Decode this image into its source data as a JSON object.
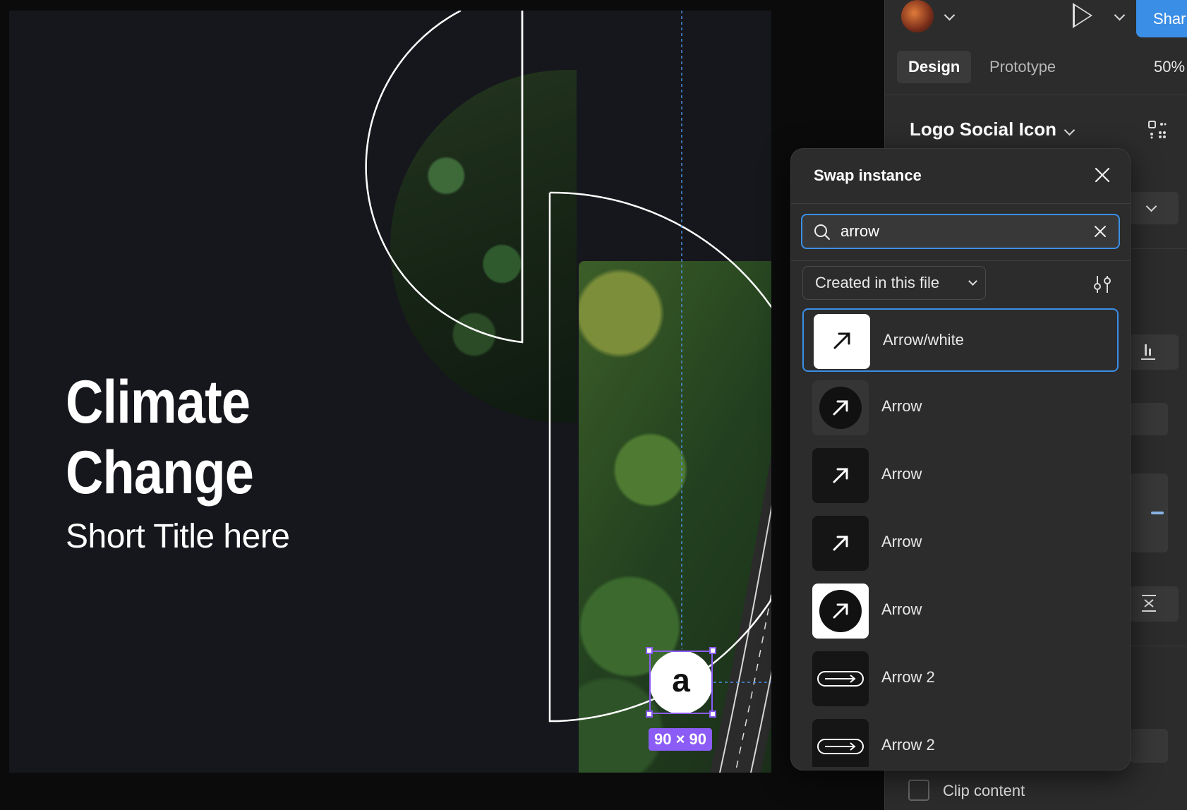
{
  "canvas": {
    "title_line1": "Climate",
    "title_line2": "Change",
    "subtitle": "Short Title here",
    "selection": {
      "size_label": "90 × 90",
      "glyph": "a"
    }
  },
  "topbar": {
    "share_label": "Shar",
    "zoom": "50%"
  },
  "panel": {
    "tabs": [
      {
        "label": "Design",
        "active": true
      },
      {
        "label": "Prototype",
        "active": false
      }
    ],
    "component_name": "Logo Social Icon",
    "clip_content_label": "Clip content"
  },
  "swap_instance": {
    "title": "Swap instance",
    "search": {
      "value": "arrow"
    },
    "filter": "Created in this file",
    "results": [
      {
        "label": "Arrow/white",
        "style": "white-square",
        "selected": true
      },
      {
        "label": "Arrow",
        "style": "dark-circle",
        "selected": false
      },
      {
        "label": "Arrow",
        "style": "dark-square",
        "selected": false
      },
      {
        "label": "Arrow",
        "style": "dark-square",
        "selected": false
      },
      {
        "label": "Arrow",
        "style": "white-circle",
        "selected": false
      },
      {
        "label": "Arrow 2",
        "style": "long-pill",
        "selected": false
      },
      {
        "label": "Arrow 2",
        "style": "long-pill",
        "selected": false
      }
    ]
  },
  "colors": {
    "accent": "#3b8ee6",
    "selection": "#8b5cf6",
    "panel_bg": "#2c2c2c",
    "canvas_bg": "#16171c"
  },
  "icons": [
    "play-icon",
    "search-icon",
    "close-icon",
    "clear-icon",
    "filter-icon",
    "grid-icon",
    "chevron-down-icon"
  ]
}
